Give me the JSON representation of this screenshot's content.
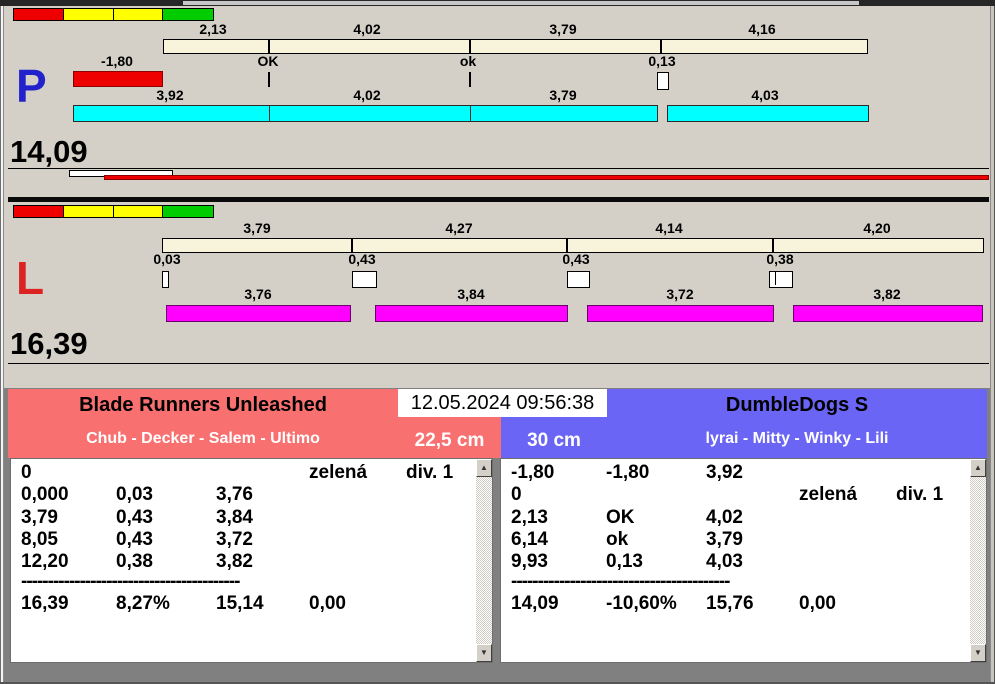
{
  "colors": {
    "background": "#d4d0c8",
    "panel_gray": "#808080",
    "scale_red": "#ee0000",
    "scale_yellow": "#ffff00",
    "scale_green": "#00cc00",
    "bar_cream": "#f8f4dc",
    "bar_cyan": "#00ffff",
    "bar_magenta": "#ff00ff",
    "bar_red": "#ee0000",
    "team_left_bg": "#f87070",
    "team_right_bg": "#6b65f6",
    "p_letter": "#2222cc",
    "l_letter": "#dd2222"
  },
  "icons": {
    "scroll_up": "▲",
    "scroll_down": "▼"
  },
  "sections": {
    "p": {
      "label": "P",
      "big_total": "14,09",
      "splits_top": [
        "2,13",
        "4,02",
        "3,79",
        "4,16"
      ],
      "exchanges": [
        "-1,80",
        "OK",
        "ok",
        "0,13"
      ],
      "splits_bottom": [
        "3,92",
        "4,02",
        "3,79",
        "4,03"
      ]
    },
    "l": {
      "label": "L",
      "big_total": "16,39",
      "splits_top": [
        "3,79",
        "4,27",
        "4,14",
        "4,20"
      ],
      "exchanges": [
        "0,03",
        "0,43",
        "0,43",
        "0,38"
      ],
      "splits_bottom": [
        "3,76",
        "3,84",
        "3,72",
        "3,82"
      ]
    }
  },
  "scoreboard": {
    "timestamp": "12.05.2024 09:56:38",
    "left": {
      "team": "Blade Runners Unleashed",
      "dogs": "Chub - Decker - Salem - Ultimo",
      "jump_height": "22,5 cm",
      "rows": [
        [
          "0",
          "",
          "",
          "zelená",
          "div. 1"
        ],
        [
          "0,000",
          "0,03",
          "3,76",
          "",
          ""
        ],
        [
          "3,79",
          "0,43",
          "3,84",
          "",
          ""
        ],
        [
          "8,05",
          "0,43",
          "3,72",
          "",
          ""
        ],
        [
          "12,20",
          "0,38",
          "3,82",
          "",
          ""
        ]
      ],
      "separator": "-----------------------------------------",
      "totals": [
        "16,39",
        "8,27%",
        "15,14",
        "0,00"
      ]
    },
    "right": {
      "team": "DumbleDogs S",
      "dogs": "lyrai - Mitty - Winky - Lili",
      "jump_height": "30 cm",
      "rows": [
        [
          "-1,80",
          "-1,80",
          "3,92",
          "",
          ""
        ],
        [
          "0",
          "",
          "",
          "zelená",
          "div. 1"
        ],
        [
          "2,13",
          "OK",
          "4,02",
          "",
          ""
        ],
        [
          "6,14",
          "ok",
          "3,79",
          "",
          ""
        ],
        [
          "9,93",
          "0,13",
          "4,03",
          "",
          ""
        ]
      ],
      "separator": "-----------------------------------------",
      "totals": [
        "14,09",
        "-10,60%",
        "15,76",
        "0,00"
      ]
    }
  }
}
